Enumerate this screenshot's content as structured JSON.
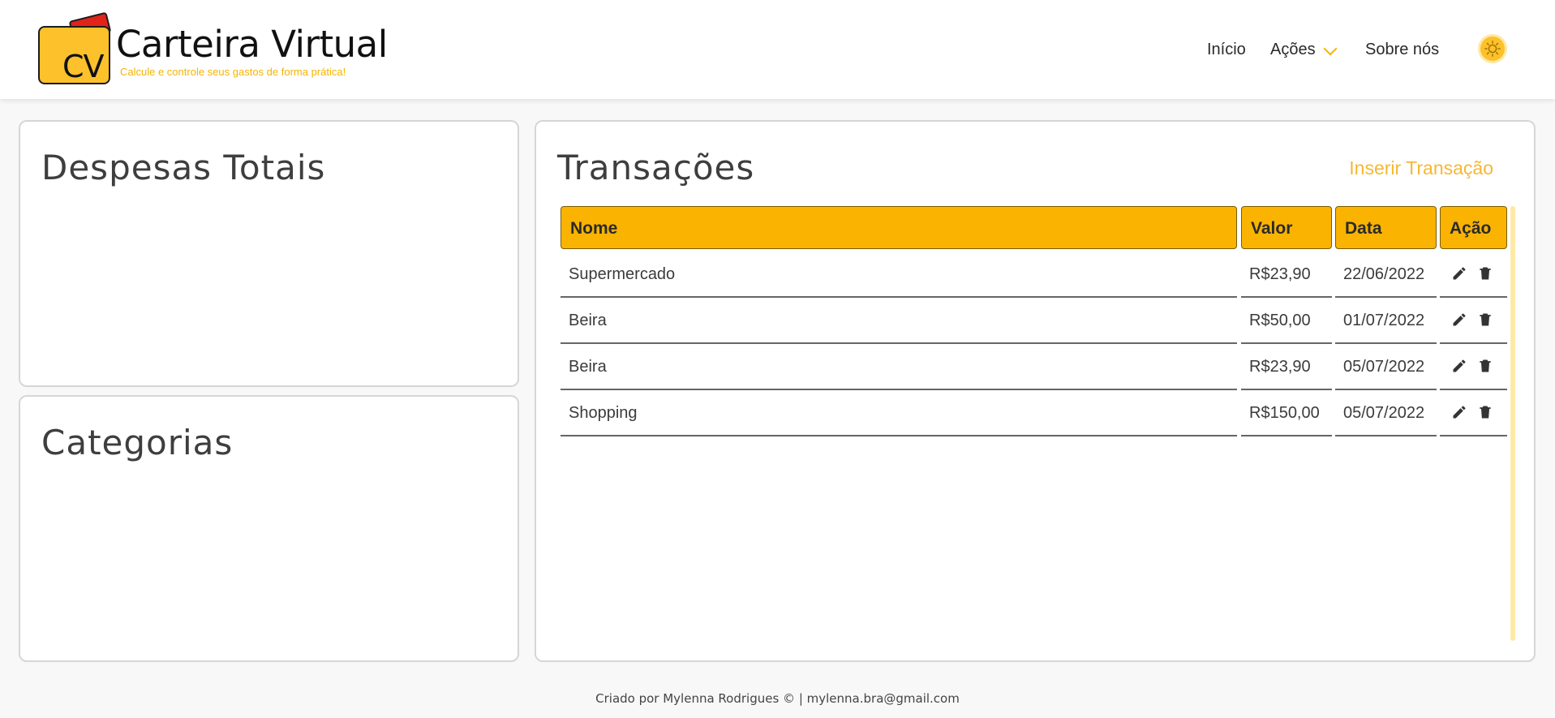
{
  "app": {
    "title": "Carteira Virtual",
    "logo_letters": "CV",
    "subtitle": "Calcule e controle seus gastos de forma prática!"
  },
  "nav": {
    "items": [
      "Início",
      "Ações",
      "Sobre nós"
    ],
    "theme_icon": "sun-icon"
  },
  "panels": {
    "totals_title": "Despesas Totais",
    "categories_title": "Categorias",
    "transactions_title": "Transações",
    "insert_label": "Inserir Transação"
  },
  "table": {
    "headers": [
      "Nome",
      "Valor",
      "Data",
      "Ação"
    ],
    "rows": [
      {
        "name": "Supermercado",
        "value": "R$23,90",
        "date": "22/06/2022"
      },
      {
        "name": "Beira",
        "value": "R$50,00",
        "date": "01/07/2022"
      },
      {
        "name": "Beira",
        "value": "R$23,90",
        "date": "05/07/2022"
      },
      {
        "name": "Shopping",
        "value": "R$150,00",
        "date": "05/07/2022"
      }
    ]
  },
  "footer": {
    "text": "Criado por Mylenna Rodrigues © | mylenna.bra@gmail.com"
  },
  "colors": {
    "accent": "#f9b300",
    "link": "#f7b733",
    "logo_card": "#fcc12b",
    "logo_tab": "#e2231a"
  }
}
